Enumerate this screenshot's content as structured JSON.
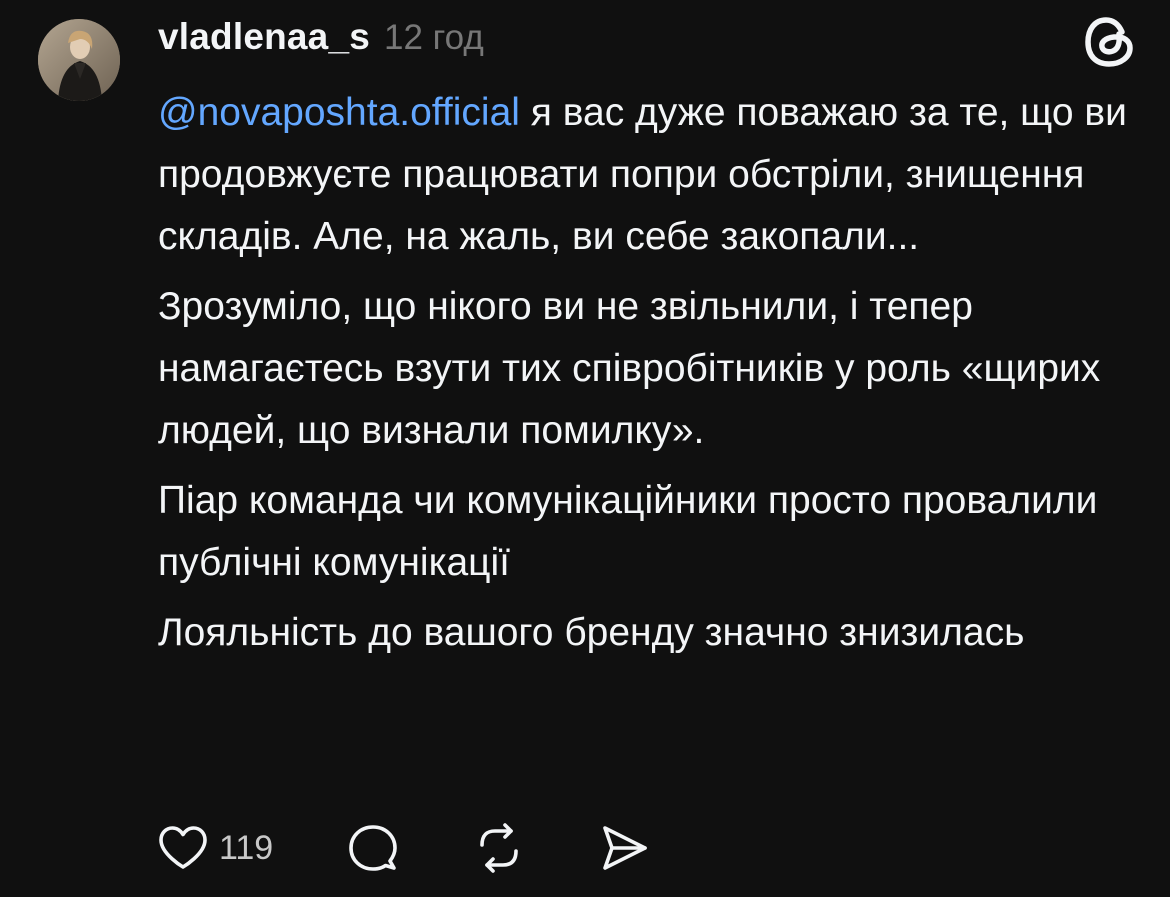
{
  "post": {
    "author": {
      "username": "vladlenaa_s",
      "avatar_icon": "user-avatar"
    },
    "time": "12 год",
    "app_icon": "threads-logo-icon",
    "mention": "@novaposhta.official",
    "paragraphs": [
      " я вас дуже поважаю за те, що ви продовжуєте працювати попри обстріли, знищення складів. Але, на жаль, ви себе закопали...",
      "Зрозуміло, що нікого ви не звільнили, і тепер намагаєтесь взути тих співробітників у роль «щирих людей, що визнали помилку».",
      "Піар команда чи комунікаційники просто провалили публічні комунікації",
      "Лояльність до вашого бренду значно знизилась"
    ],
    "actions": {
      "like_icon": "heart-icon",
      "like_count": "119",
      "reply_icon": "comment-bubble-icon",
      "repost_icon": "repost-icon",
      "share_icon": "send-icon"
    }
  },
  "colors": {
    "background": "#101010",
    "text": "#f3f5f7",
    "secondary": "#777777",
    "mention": "#63a7ff"
  }
}
